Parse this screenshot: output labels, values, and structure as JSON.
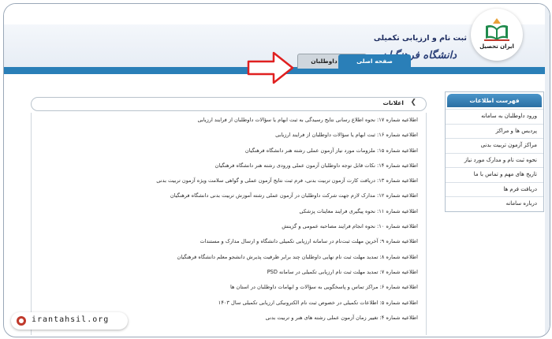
{
  "header": {
    "site_title": "ثبت نام و ارزیابی تکمیلی",
    "site_subtitle": "دانشگاه فرهنگیان"
  },
  "tabs": [
    {
      "label": "صفحه اصلی",
      "active": true
    },
    {
      "label": "ورود داوطلبان",
      "active": false
    }
  ],
  "logo": {
    "text": "ایران تحصیل"
  },
  "sidebar": {
    "title": "فهرست اطلاعات",
    "items": [
      {
        "label": "ورود داوطلبان به سامانه"
      },
      {
        "label": "پردیس ها و مراکز"
      },
      {
        "label": "مراکز آزمون تربیت بدنی"
      },
      {
        "label": "نحوه ثبت نام و مدارک مورد نیاز"
      },
      {
        "label": "تاریخ های مهم و تماس با ما"
      },
      {
        "label": "دریافت فرم ها"
      },
      {
        "label": "درباره سامانه"
      }
    ]
  },
  "announcements": {
    "title": "اعلانات",
    "items": [
      {
        "text": "اطلاعیه شماره ۱۷: نحوه اطلاع رسانی نتایج رسیدگی به ثبت ابهام یا سؤالات داوطلبان از فرایند ارزیابی"
      },
      {
        "text": "اطلاعیه شماره ۱۶: ثبت ابهام یا سؤالات داوطلبان از فرایند ارزیابی"
      },
      {
        "text": "اطلاعیه شماره ۱۵: ملزومات مورد نیاز آزمون عملی رشته هنر دانشگاه فرهنگیان"
      },
      {
        "text": "اطلاعیه شماره ۱۴: نکات قابل توجه داوطلبان آزمون عملی ورودی رشته هنر دانشگاه فرهنگیان"
      },
      {
        "text": "اطلاعیه شماره ۱۳: دریافت کارت آزمون تربیت بدنی، فرم ثبت نتایج آزمون عملی و گواهی سلامت ویژه آزمون تربیت بدنی"
      },
      {
        "text": "اطلاعیه شماره ۱۲: مدارک لازم جهت شرکت داوطلبان در آزمون عملی رشته آموزش تربیت بدنی دانشگاه فرهنگیان"
      },
      {
        "text": "اطلاعیه شماره ۱۱: نحوه پیگیری فرایند معاینات پزشکی"
      },
      {
        "text": "اطلاعیه شماره ۱۰: نحوه انجام فرایند مصاحبه عمومی و گزینش"
      },
      {
        "text": "اطلاعیه شماره ۹: آخرین مهلت ثبت‌نام در سامانه ارزیابی تکمیلی دانشگاه و ارسال مدارک و مستندات"
      },
      {
        "text": "اطلاعیه شماره ۸: تمدید مهلت ثبت نام نهایی داوطلبان چند برابر ظرفیت پذیرش دانشجو معلم دانشگاه فرهنگیان"
      },
      {
        "text": "اطلاعیه شماره ۷: تمدید مهلت ثبت نام ارزیابی تکمیلی در سامانه PSD"
      },
      {
        "text": "اطلاعیه شماره ۶: مراکز تماس و پاسخگویی به سؤالات و ابهامات داوطلبان در استان ها"
      },
      {
        "text": "اطلاعیه شماره ۵: اطلاعات تکمیلی در خصوص ثبت نام الکترونیکی ارزیابی تکمیلی سال ۱۴۰۳"
      },
      {
        "text": "اطلاعیه شماره ۴: تغییر زمان آزمون عملی رشته های هنر و تربیت بدنی"
      }
    ]
  },
  "watermark": {
    "site": "irantahsil.org"
  },
  "colors": {
    "accent": "#2a7fb8",
    "arrow": "#e02020",
    "badge": "#c0392b"
  }
}
